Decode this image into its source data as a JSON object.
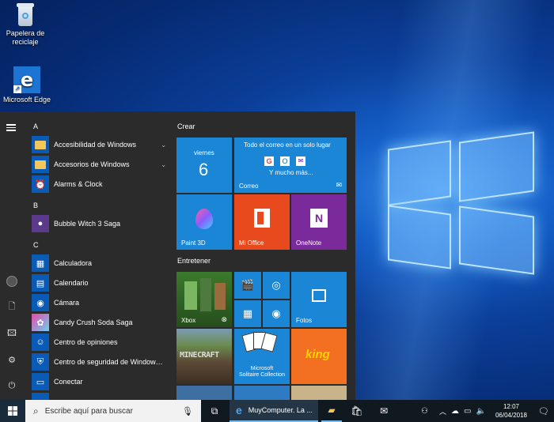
{
  "desktop": {
    "icons": [
      {
        "label_line1": "Papelera de",
        "label_line2": "reciclaje",
        "icon": "recycle-bin-icon"
      },
      {
        "label_line1": "Microsoft Edge",
        "label_line2": "",
        "icon": "edge-icon"
      }
    ]
  },
  "start_menu": {
    "rail_icons": [
      "hamburger-menu-icon",
      "user-avatar-icon",
      "documents-icon",
      "pictures-icon",
      "settings-icon",
      "power-icon"
    ],
    "sections": [
      {
        "letter": "A",
        "apps": [
          {
            "label": "Accesibilidad de Windows",
            "icon": "folder-icon",
            "expandable": true
          },
          {
            "label": "Accesorios de Windows",
            "icon": "folder-icon",
            "expandable": true
          },
          {
            "label": "Alarms & Clock",
            "icon": "alarm-clock-icon",
            "expandable": false
          }
        ]
      },
      {
        "letter": "B",
        "apps": [
          {
            "label": "Bubble Witch 3 Saga",
            "icon": "bubble-witch-icon",
            "expandable": false
          }
        ]
      },
      {
        "letter": "C",
        "apps": [
          {
            "label": "Calculadora",
            "icon": "calculator-icon",
            "expandable": false
          },
          {
            "label": "Calendario",
            "icon": "calendar-icon",
            "expandable": false
          },
          {
            "label": "Cámara",
            "icon": "camera-icon",
            "expandable": false
          },
          {
            "label": "Candy Crush Soda Saga",
            "icon": "candy-crush-icon",
            "expandable": false
          },
          {
            "label": "Centro de opiniones",
            "icon": "feedback-icon",
            "expandable": false
          },
          {
            "label": "Centro de seguridad de Windows D...",
            "icon": "shield-icon",
            "expandable": false
          },
          {
            "label": "Conectar",
            "icon": "connect-icon",
            "expandable": false
          }
        ]
      }
    ],
    "chevron": "⌄",
    "tiles": {
      "group_create": "Crear",
      "group_entertain": "Entretener",
      "calendar_day": "viernes",
      "calendar_date": "6",
      "mail_headline": "Todo el correo en un solo lugar",
      "mail_more": "Y mucho más...",
      "mail_label": "Correo",
      "paint3d": "Paint 3D",
      "office": "Mi Office",
      "onenote": "OneNote",
      "xbox": "Xbox",
      "minecraft": "MINECRAFT",
      "solitaire_line1": "Microsoft",
      "solitaire_line2": "Solitaire Collection",
      "photos": "Fotos",
      "king": "king"
    }
  },
  "taskbar": {
    "search_placeholder": "Escribe aquí para buscar",
    "edge_window": "MuyComputer. La ...",
    "time": "12:07",
    "date": "06/04/2018",
    "accent": "#0078d7"
  }
}
